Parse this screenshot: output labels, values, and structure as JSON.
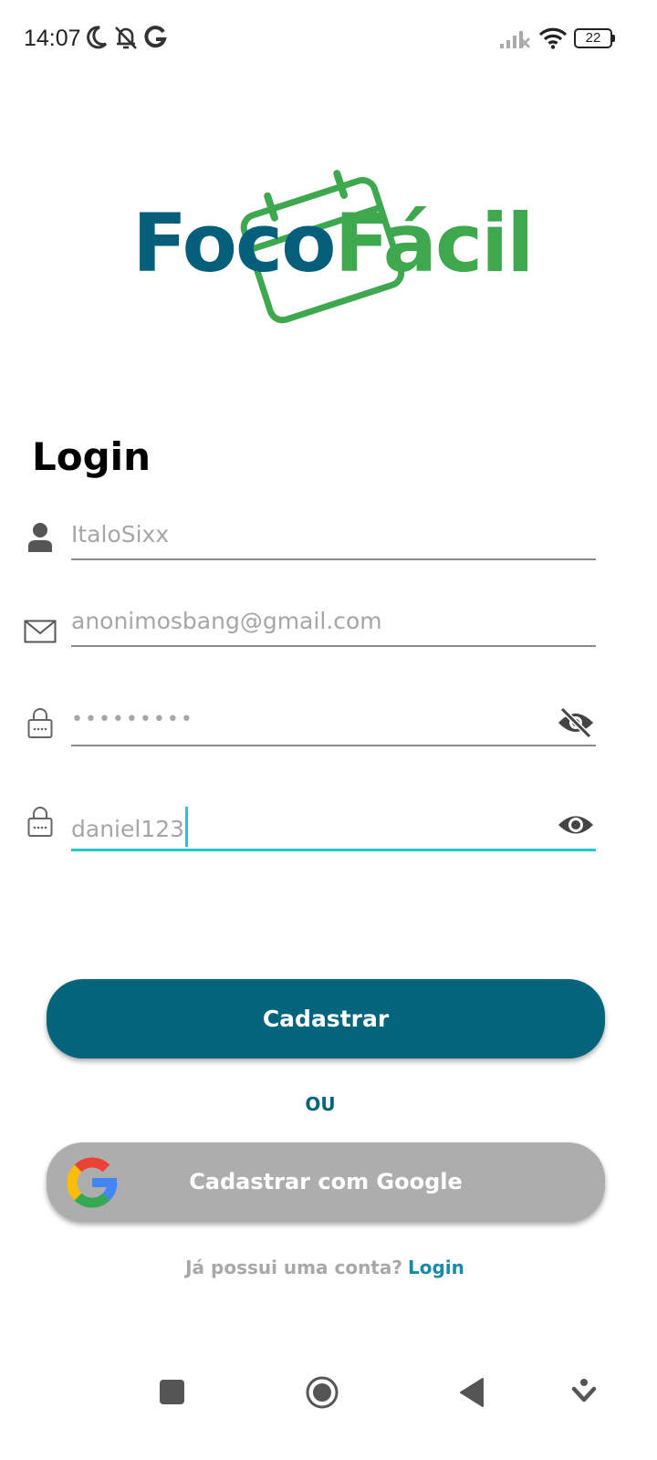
{
  "status_bar": {
    "time": "14:07",
    "battery": "22",
    "icons": [
      "moon-icon",
      "bell-off-icon",
      "google-g-icon",
      "signal-icon",
      "wifi-icon",
      "battery-icon"
    ]
  },
  "logo": {
    "part1": "Foco",
    "part2": "Fácil",
    "colors": {
      "foco": "#055f7a",
      "facil": "#3ea84f"
    }
  },
  "page": {
    "title": "Login"
  },
  "fields": {
    "username": {
      "value": "ItaloSixx",
      "icon": "person-icon"
    },
    "email": {
      "value": "anonimosbang@gmail.com",
      "icon": "mail-icon"
    },
    "password": {
      "value": "•••••••••",
      "icon": "lock-icon",
      "toggle_icon": "eye-off-icon"
    },
    "confirm_password": {
      "value": "daniel123",
      "icon": "lock-icon",
      "toggle_icon": "eye-icon",
      "focused": true
    }
  },
  "buttons": {
    "register": "Cadastrar",
    "or": "OU",
    "google": "Cadastrar com Google"
  },
  "footer": {
    "question": "Já possui uma conta?",
    "link": "Login"
  },
  "colors": {
    "primary": "#04647c",
    "accent": "#27c8c9",
    "google_button": "#adadad"
  },
  "nav_bar": {
    "icons": [
      "recents-icon",
      "home-icon",
      "back-icon",
      "assistant-icon"
    ]
  }
}
